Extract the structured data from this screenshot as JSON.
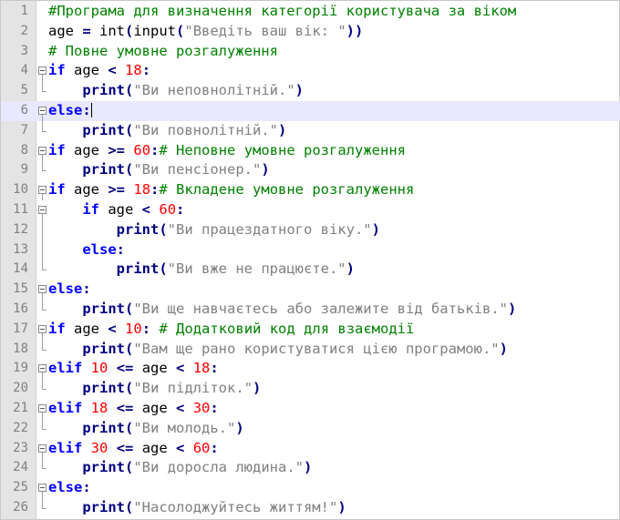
{
  "editor": {
    "current_line": 6,
    "lines": [
      {
        "n": "1",
        "tokens": [
          {
            "t": "com",
            "v": "#Програма для визначення категорії користувача за віком"
          }
        ]
      },
      {
        "n": "2",
        "tokens": [
          {
            "t": "plain",
            "v": "age "
          },
          {
            "t": "op",
            "v": "="
          },
          {
            "t": "plain",
            "v": " int"
          },
          {
            "t": "op",
            "v": "("
          },
          {
            "t": "plain",
            "v": "input"
          },
          {
            "t": "op",
            "v": "("
          },
          {
            "t": "str",
            "v": "\"Введіть ваш вік: \""
          },
          {
            "t": "op",
            "v": "))"
          }
        ]
      },
      {
        "n": "3",
        "tokens": [
          {
            "t": "com",
            "v": "# Повне умовне розгалуження"
          }
        ]
      },
      {
        "n": "4",
        "tokens": [
          {
            "t": "kw",
            "v": "if"
          },
          {
            "t": "plain",
            "v": " age "
          },
          {
            "t": "op",
            "v": "<"
          },
          {
            "t": "plain",
            "v": " "
          },
          {
            "t": "num",
            "v": "18"
          },
          {
            "t": "op",
            "v": ":"
          }
        ]
      },
      {
        "n": "5",
        "tokens": [
          {
            "t": "plain",
            "v": "    "
          },
          {
            "t": "bi",
            "v": "print"
          },
          {
            "t": "op",
            "v": "("
          },
          {
            "t": "str",
            "v": "\"Ви неповнолітній.\""
          },
          {
            "t": "op",
            "v": ")"
          }
        ]
      },
      {
        "n": "6",
        "tokens": [
          {
            "t": "kw",
            "v": "else"
          },
          {
            "t": "op",
            "v": ":"
          }
        ]
      },
      {
        "n": "7",
        "tokens": [
          {
            "t": "plain",
            "v": "    "
          },
          {
            "t": "bi",
            "v": "print"
          },
          {
            "t": "op",
            "v": "("
          },
          {
            "t": "str",
            "v": "\"Ви повнолітній.\""
          },
          {
            "t": "op",
            "v": ")"
          }
        ]
      },
      {
        "n": "8",
        "tokens": [
          {
            "t": "kw",
            "v": "if"
          },
          {
            "t": "plain",
            "v": " age "
          },
          {
            "t": "op",
            "v": ">="
          },
          {
            "t": "plain",
            "v": " "
          },
          {
            "t": "num",
            "v": "60"
          },
          {
            "t": "op",
            "v": ":"
          },
          {
            "t": "com",
            "v": "# Неповне умовне розгалуження"
          }
        ]
      },
      {
        "n": "9",
        "tokens": [
          {
            "t": "plain",
            "v": "    "
          },
          {
            "t": "bi",
            "v": "print"
          },
          {
            "t": "op",
            "v": "("
          },
          {
            "t": "str",
            "v": "\"Ви пенсіонер.\""
          },
          {
            "t": "op",
            "v": ")"
          }
        ]
      },
      {
        "n": "10",
        "tokens": [
          {
            "t": "kw",
            "v": "if"
          },
          {
            "t": "plain",
            "v": " age "
          },
          {
            "t": "op",
            "v": ">="
          },
          {
            "t": "plain",
            "v": " "
          },
          {
            "t": "num",
            "v": "18"
          },
          {
            "t": "op",
            "v": ":"
          },
          {
            "t": "com",
            "v": "# Вкладене умовне розгалуження"
          }
        ]
      },
      {
        "n": "11",
        "tokens": [
          {
            "t": "plain",
            "v": "    "
          },
          {
            "t": "kw",
            "v": "if"
          },
          {
            "t": "plain",
            "v": " age "
          },
          {
            "t": "op",
            "v": "<"
          },
          {
            "t": "plain",
            "v": " "
          },
          {
            "t": "num",
            "v": "60"
          },
          {
            "t": "op",
            "v": ":"
          }
        ]
      },
      {
        "n": "12",
        "tokens": [
          {
            "t": "plain",
            "v": "        "
          },
          {
            "t": "bi",
            "v": "print"
          },
          {
            "t": "op",
            "v": "("
          },
          {
            "t": "str",
            "v": "\"Ви працездатного віку.\""
          },
          {
            "t": "op",
            "v": ")"
          }
        ]
      },
      {
        "n": "13",
        "tokens": [
          {
            "t": "plain",
            "v": "    "
          },
          {
            "t": "kw",
            "v": "else"
          },
          {
            "t": "op",
            "v": ":"
          }
        ]
      },
      {
        "n": "14",
        "tokens": [
          {
            "t": "plain",
            "v": "        "
          },
          {
            "t": "bi",
            "v": "print"
          },
          {
            "t": "op",
            "v": "("
          },
          {
            "t": "str",
            "v": "\"Ви вже не працюєте.\""
          },
          {
            "t": "op",
            "v": ")"
          }
        ]
      },
      {
        "n": "15",
        "tokens": [
          {
            "t": "kw",
            "v": "else"
          },
          {
            "t": "op",
            "v": ":"
          }
        ]
      },
      {
        "n": "16",
        "tokens": [
          {
            "t": "plain",
            "v": "    "
          },
          {
            "t": "bi",
            "v": "print"
          },
          {
            "t": "op",
            "v": "("
          },
          {
            "t": "str",
            "v": "\"Ви ще навчаєтесь або залежите від батьків.\""
          },
          {
            "t": "op",
            "v": ")"
          }
        ]
      },
      {
        "n": "17",
        "tokens": [
          {
            "t": "kw",
            "v": "if"
          },
          {
            "t": "plain",
            "v": " age "
          },
          {
            "t": "op",
            "v": "<"
          },
          {
            "t": "plain",
            "v": " "
          },
          {
            "t": "num",
            "v": "10"
          },
          {
            "t": "op",
            "v": ":"
          },
          {
            "t": "plain",
            "v": " "
          },
          {
            "t": "com",
            "v": "# Додатковий код для взаємодії"
          }
        ]
      },
      {
        "n": "18",
        "tokens": [
          {
            "t": "plain",
            "v": "    "
          },
          {
            "t": "bi",
            "v": "print"
          },
          {
            "t": "op",
            "v": "("
          },
          {
            "t": "str",
            "v": "\"Вам ще рано користуватися цією програмою.\""
          },
          {
            "t": "op",
            "v": ")"
          }
        ]
      },
      {
        "n": "19",
        "tokens": [
          {
            "t": "kw",
            "v": "elif"
          },
          {
            "t": "plain",
            "v": " "
          },
          {
            "t": "num",
            "v": "10"
          },
          {
            "t": "plain",
            "v": " "
          },
          {
            "t": "op",
            "v": "<="
          },
          {
            "t": "plain",
            "v": " age "
          },
          {
            "t": "op",
            "v": "<"
          },
          {
            "t": "plain",
            "v": " "
          },
          {
            "t": "num",
            "v": "18"
          },
          {
            "t": "op",
            "v": ":"
          }
        ]
      },
      {
        "n": "20",
        "tokens": [
          {
            "t": "plain",
            "v": "    "
          },
          {
            "t": "bi",
            "v": "print"
          },
          {
            "t": "op",
            "v": "("
          },
          {
            "t": "str",
            "v": "\"Ви підліток.\""
          },
          {
            "t": "op",
            "v": ")"
          }
        ]
      },
      {
        "n": "21",
        "tokens": [
          {
            "t": "kw",
            "v": "elif"
          },
          {
            "t": "plain",
            "v": " "
          },
          {
            "t": "num",
            "v": "18"
          },
          {
            "t": "plain",
            "v": " "
          },
          {
            "t": "op",
            "v": "<="
          },
          {
            "t": "plain",
            "v": " age "
          },
          {
            "t": "op",
            "v": "<"
          },
          {
            "t": "plain",
            "v": " "
          },
          {
            "t": "num",
            "v": "30"
          },
          {
            "t": "op",
            "v": ":"
          }
        ]
      },
      {
        "n": "22",
        "tokens": [
          {
            "t": "plain",
            "v": "    "
          },
          {
            "t": "bi",
            "v": "print"
          },
          {
            "t": "op",
            "v": "("
          },
          {
            "t": "str",
            "v": "\"Ви молодь.\""
          },
          {
            "t": "op",
            "v": ")"
          }
        ]
      },
      {
        "n": "23",
        "tokens": [
          {
            "t": "kw",
            "v": "elif"
          },
          {
            "t": "plain",
            "v": " "
          },
          {
            "t": "num",
            "v": "30"
          },
          {
            "t": "plain",
            "v": " "
          },
          {
            "t": "op",
            "v": "<="
          },
          {
            "t": "plain",
            "v": " age "
          },
          {
            "t": "op",
            "v": "<"
          },
          {
            "t": "plain",
            "v": " "
          },
          {
            "t": "num",
            "v": "60"
          },
          {
            "t": "op",
            "v": ":"
          }
        ]
      },
      {
        "n": "24",
        "tokens": [
          {
            "t": "plain",
            "v": "    "
          },
          {
            "t": "bi",
            "v": "print"
          },
          {
            "t": "op",
            "v": "("
          },
          {
            "t": "str",
            "v": "\"Ви доросла людина.\""
          },
          {
            "t": "op",
            "v": ")"
          }
        ]
      },
      {
        "n": "25",
        "tokens": [
          {
            "t": "kw",
            "v": "else"
          },
          {
            "t": "op",
            "v": ":"
          }
        ]
      },
      {
        "n": "26",
        "tokens": [
          {
            "t": "plain",
            "v": "    "
          },
          {
            "t": "bi",
            "v": "print"
          },
          {
            "t": "op",
            "v": "("
          },
          {
            "t": "str",
            "v": "\"Насолоджуйтесь життям!\""
          },
          {
            "t": "op",
            "v": ")"
          }
        ]
      }
    ]
  },
  "colors": {
    "keyword": "#0000ff",
    "builtin": "#000080",
    "string": "#808080",
    "number": "#ff0000",
    "comment": "#008000",
    "current_line_bg": "#e8e8ff",
    "gutter_bg": "#e4e4e4"
  }
}
